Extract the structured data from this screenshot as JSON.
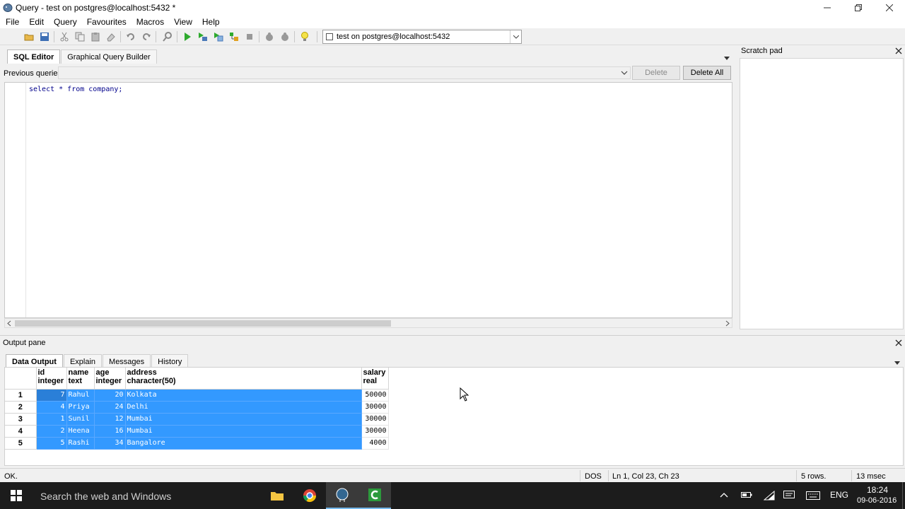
{
  "window": {
    "title": "Query - test on postgres@localhost:5432 *"
  },
  "menu": [
    "File",
    "Edit",
    "Query",
    "Favourites",
    "Macros",
    "View",
    "Help"
  ],
  "toolbar": {
    "connection": "test on postgres@localhost:5432"
  },
  "editor": {
    "tabs": [
      "SQL Editor",
      "Graphical Query Builder"
    ],
    "previous_queries_label": "Previous queries",
    "delete_label": "Delete",
    "delete_all_label": "Delete All",
    "code": "select * from company;"
  },
  "scratch_pad": {
    "title": "Scratch pad"
  },
  "output": {
    "title": "Output pane",
    "tabs": [
      "Data Output",
      "Explain",
      "Messages",
      "History"
    ],
    "columns": [
      {
        "name": "id",
        "type": "integer"
      },
      {
        "name": "name",
        "type": "text"
      },
      {
        "name": "age",
        "type": "integer"
      },
      {
        "name": "address",
        "type": "character(50)"
      },
      {
        "name": "salary",
        "type": "real"
      }
    ],
    "rows": [
      [
        "1",
        "7",
        "Rahul",
        "20",
        "Kolkata",
        "50000"
      ],
      [
        "2",
        "4",
        "Priya",
        "24",
        "Delhi",
        "30000"
      ],
      [
        "3",
        "1",
        "Sunil",
        "12",
        "Mumbai",
        "30000"
      ],
      [
        "4",
        "2",
        "Heena",
        "16",
        "Mumbai",
        "30000"
      ],
      [
        "5",
        "5",
        "Rashi",
        "34",
        "Bangalore",
        "4000"
      ]
    ]
  },
  "status": {
    "message": "OK.",
    "encoding": "DOS",
    "position": "Ln 1, Col 23, Ch 23",
    "rows": "5 rows.",
    "time": "13 msec"
  },
  "taskbar": {
    "search_placeholder": "Search the web and Windows",
    "language": "ENG",
    "clock_time": "18:24",
    "clock_date": "09-06-2016"
  },
  "colors": {
    "selection": "#3399ff",
    "taskbar": "#1c1c1c",
    "code": "#00008b"
  }
}
